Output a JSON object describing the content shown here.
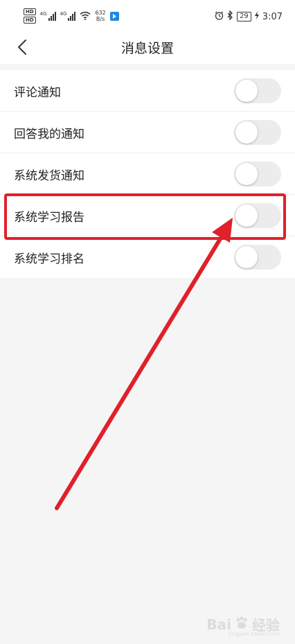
{
  "status_bar": {
    "hd_label_1": "HD",
    "hd_label_2": "HD",
    "signal_1_tag": "4G",
    "signal_2_tag": "4G",
    "net_speed_value": "632",
    "net_speed_unit": "B/s",
    "battery": "29",
    "time": "3:07",
    "icons": [
      "alarm-icon",
      "bluetooth-icon",
      "charging-icon",
      "wifi-icon"
    ]
  },
  "header": {
    "title": "消息设置",
    "back_icon": "chevron-left-icon"
  },
  "settings": {
    "items": [
      {
        "label": "评论通知",
        "enabled": false
      },
      {
        "label": "回答我的通知",
        "enabled": false
      },
      {
        "label": "系统发货通知",
        "enabled": false
      },
      {
        "label": "系统学习报告",
        "enabled": false,
        "highlighted": true
      },
      {
        "label": "系统学习排名",
        "enabled": false
      }
    ]
  },
  "annotation": {
    "box_color": "#e0202a",
    "arrow_color": "#e0202a"
  },
  "watermark": {
    "text": "Bai",
    "text_cn": "经验",
    "sub": "jingyan.baidu.com"
  },
  "colors": {
    "toggle_off": "#ececec",
    "background": "#f5f5f5"
  }
}
